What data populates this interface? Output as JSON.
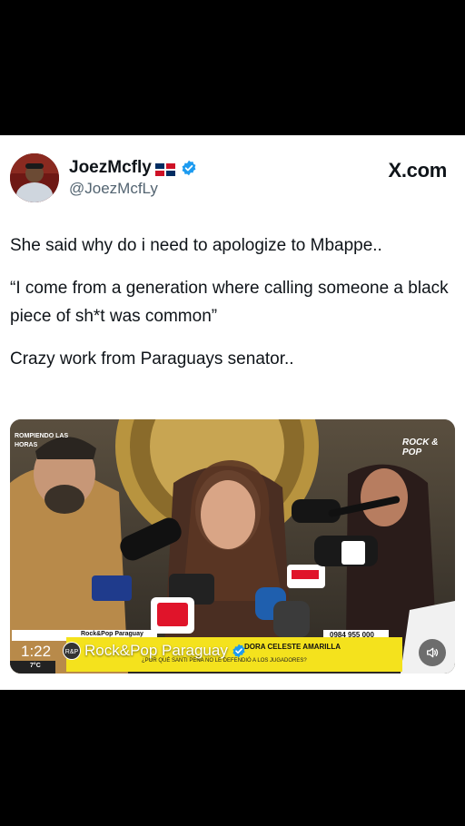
{
  "tweet": {
    "display_name": "JoezMcfly",
    "handle": "@JoezMcfLy",
    "source": "X.com",
    "lines": [
      "She said why do i need to apologize to Mbappe..",
      "“I come from a generation where calling someone a black piece of sh*t was common”",
      "Crazy work from Paraguays senator.."
    ]
  },
  "video": {
    "top_left_badge": "ROMPIENDO LAS HORAS",
    "top_right_logo": "ROCK & POP",
    "phone_tag": "0984 955 000",
    "lower_third_title": "DORA CELESTE AMARILLA",
    "lower_third_sub": "¿POR QUÉ SANTI PEÑA NO LE DEFENDIÓ A LOS JUGADORES?",
    "temperature": "7°C",
    "time_remaining": "1:22",
    "channel_name": "Rock&Pop Paraguay",
    "small_channel_tag": "Rock&Pop Paraguay"
  },
  "colors": {
    "verified": "#1d9bf0",
    "lower_third": "#f4e21d"
  }
}
